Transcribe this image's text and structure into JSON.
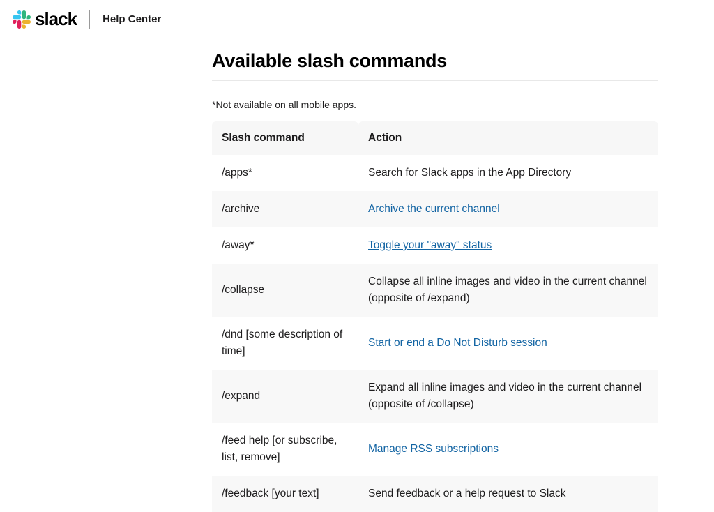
{
  "header": {
    "brand": "slack",
    "help_center": "Help Center"
  },
  "main": {
    "title": "Available slash commands",
    "footnote": "*Not available on all mobile apps.",
    "table": {
      "headers": {
        "command": "Slash command",
        "action": "Action"
      },
      "rows": [
        {
          "command": "/apps*",
          "action": "Search for Slack apps in the App Directory",
          "is_link": false
        },
        {
          "command": "/archive",
          "action": "Archive the current channel",
          "is_link": true
        },
        {
          "command": "/away*",
          "action": "Toggle your \"away\" status",
          "is_link": true
        },
        {
          "command": "/collapse",
          "action": "Collapse all inline images and video in the current channel (opposite of /expand)",
          "is_link": false
        },
        {
          "command": "/dnd [some description of time]",
          "action": "Start or end a Do Not Disturb session",
          "is_link": true
        },
        {
          "command": "/expand",
          "action": "Expand all inline images and video in the current channel (opposite of /collapse)",
          "is_link": false
        },
        {
          "command": "/feed help [or subscribe, list, remove]",
          "action": "Manage RSS subscriptions",
          "is_link": true
        },
        {
          "command": "/feedback [your text]",
          "action": "Send feedback or a help request to Slack",
          "is_link": false
        }
      ]
    }
  }
}
